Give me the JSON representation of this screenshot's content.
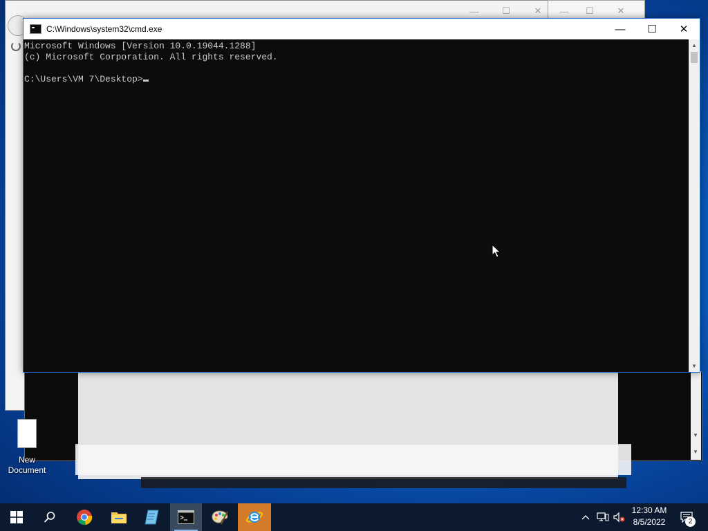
{
  "cmd_window": {
    "title": "C:\\Windows\\system32\\cmd.exe",
    "lines": [
      "Microsoft Windows [Version 10.0.19044.1288]",
      "(c) Microsoft Corporation. All rights reserved.",
      "",
      "C:\\Users\\VM 7\\Desktop>"
    ],
    "controls": {
      "minimize": "—",
      "maximize": "☐",
      "close": "✕"
    }
  },
  "background_windows": {
    "controls": {
      "minimize": "—",
      "maximize": "☐",
      "close": "✕"
    }
  },
  "desktop": {
    "icons": [
      {
        "label": "New\nDocument",
        "icon": "text-document-icon"
      }
    ]
  },
  "taskbar": {
    "start_icon": "windows-logo-icon",
    "search_icon": "search-icon",
    "apps": [
      {
        "name": "chrome",
        "icon": "chrome-icon"
      },
      {
        "name": "file-explorer",
        "icon": "folder-icon"
      },
      {
        "name": "notepad",
        "icon": "notepad-icon"
      },
      {
        "name": "cmd",
        "icon": "cmd-icon",
        "active": true
      },
      {
        "name": "paint",
        "icon": "paint-palette-icon"
      },
      {
        "name": "internet-explorer",
        "icon": "ie-icon",
        "highlight": true
      }
    ],
    "tray": {
      "chevron": "^",
      "time": "12:30 AM",
      "date": "8/5/2022",
      "notification_count": "2"
    }
  },
  "colors": {
    "console_bg": "#0c0c0c",
    "console_fg": "#cccccc",
    "taskbar_bg": "#0b1a2e",
    "accent": "#1e6fc7"
  }
}
